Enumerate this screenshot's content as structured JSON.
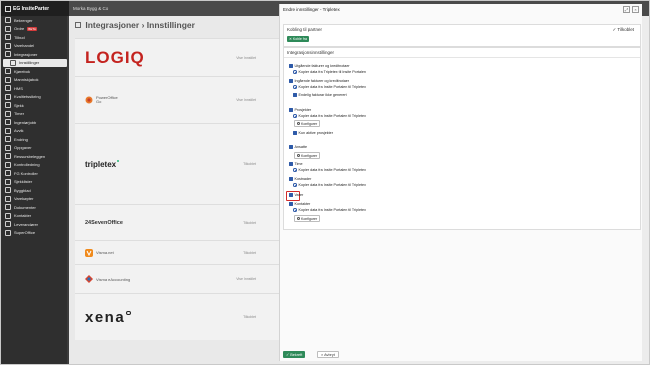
{
  "app": {
    "brand": "EG InsiteParter",
    "tenant": "Morka Bygg & Co"
  },
  "sidebar": {
    "items": [
      {
        "label": "Bekrenger"
      },
      {
        "label": "Ordre",
        "badge": "BETA"
      },
      {
        "label": "Tilbud"
      },
      {
        "label": "Varehandel"
      },
      {
        "label": "Integrasjoner"
      },
      {
        "label": "Innstillinger",
        "active": true
      },
      {
        "label": "Kjørebok"
      },
      {
        "label": "Manniskjabok"
      },
      {
        "label": "HMS"
      },
      {
        "label": "Kvalitetssikring"
      },
      {
        "label": "Sjekk"
      },
      {
        "label": "Timer"
      },
      {
        "label": "Ingeniørjobb"
      },
      {
        "label": "Avvik"
      },
      {
        "label": "Endring"
      },
      {
        "label": "Oppgaver"
      },
      {
        "label": "Ressursbeleggen"
      },
      {
        "label": "Kontrolledning"
      },
      {
        "label": "FG Kontroller"
      },
      {
        "label": "Sjekklister"
      },
      {
        "label": "Byggblad"
      },
      {
        "label": "Varekøpter"
      },
      {
        "label": "Dokumenter"
      },
      {
        "label": "Kontakter"
      },
      {
        "label": "Leverandører"
      },
      {
        "label": "SuperOffice"
      }
    ]
  },
  "page": {
    "title": "Integrasjoner › Innstillinger"
  },
  "integrations": [
    {
      "name": "LOGIQ",
      "link": "Vise Innstilet"
    },
    {
      "name": "PowerOffice Go",
      "link": "Vise Innstilet"
    },
    {
      "name": "tripletex",
      "link": "Tilkoblet"
    },
    {
      "name": "24SevenOffice",
      "link": "Tilkoblet"
    },
    {
      "name": "Visma.net",
      "link": "Tilkoblet"
    },
    {
      "name": "Visma eAccounting",
      "link": "Vise Innstilet"
    },
    {
      "name": "xena",
      "link": "Tilkoblet"
    }
  ],
  "modal": {
    "title": "Endre innstillinger - Tripletex",
    "connection": {
      "label": "Kobling til partner",
      "status": "Tilkoblet",
      "button": "Koble fra"
    },
    "settings_header": "Integrasjonsinnstillinger",
    "groups": [
      {
        "label": "Utgående fakturer og kreditnotaer",
        "option": "Kopier data fra Tripletex til Insite Portalen"
      },
      {
        "label": "Ingående fakturer og kreditnotaer",
        "option": "Kopier data fra Insite Portalen til Tripletex",
        "extra": "Endelig fakturar ikke generert"
      },
      {
        "label": "Prosjekter",
        "option": "Kopier data fra Insite Portalen til Tripletex",
        "configure": "Konfigurer",
        "extra": "Kun aktive prosjekter"
      },
      {
        "label": "Ansatte",
        "configure": "Konfigurer"
      },
      {
        "label": "Time",
        "option": "Kopier data fra Insite Portalen til Tripletex"
      },
      {
        "label": "Kostnader",
        "option": "Kopier data fra Insite Portalen til Tripletex"
      },
      {
        "label": "Varer",
        "highlighted": true
      },
      {
        "label": "Kontakter",
        "option": "Kopier data fra Insite Portalen til Tripletex",
        "configure": "Konfigurer"
      }
    ],
    "footer": {
      "save": "Bekreft",
      "cancel": "Avbryt"
    }
  }
}
